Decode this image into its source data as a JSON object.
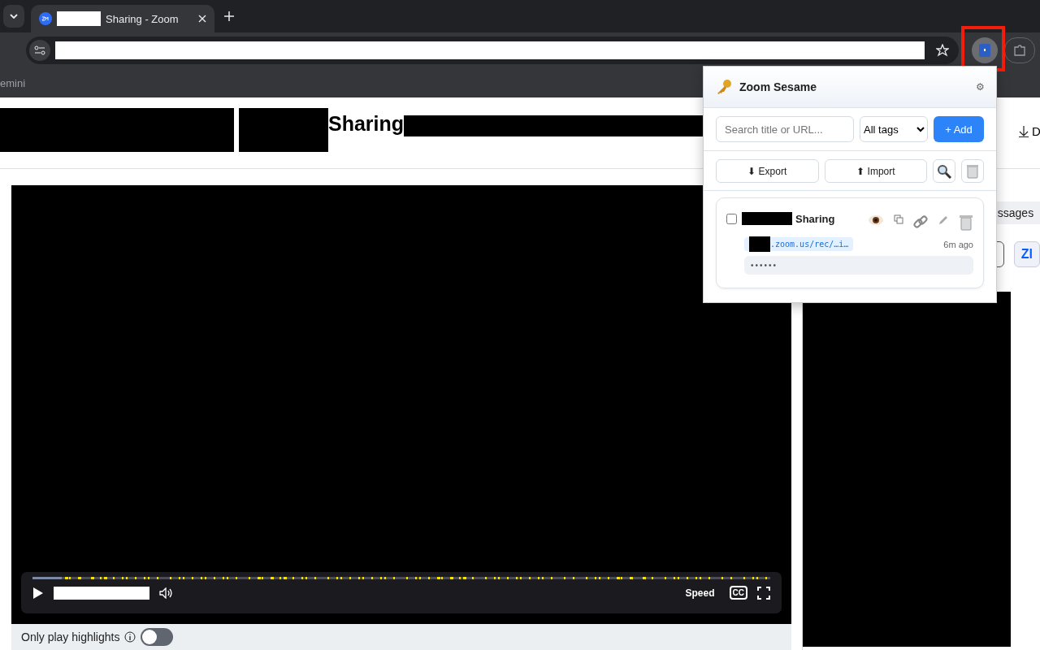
{
  "browser": {
    "tab": {
      "title": "Sharing - Zoom",
      "selected": true
    },
    "bookmark": "emini"
  },
  "page": {
    "title": "Sharing",
    "download": "D",
    "side_tab": "ssages",
    "side_button": "Zl"
  },
  "player": {
    "speed": "Speed",
    "cc": "CC",
    "highlights_label": "Only play highlights",
    "highlights_on": false
  },
  "popup": {
    "title": "Zoom Sesame",
    "settings": "⚙",
    "search": {
      "placeholder": "Search title or URL..."
    },
    "tag_filter": "All tags",
    "add": "+ Add",
    "export": "⬇ Export",
    "import": "⬆ Import",
    "entries": [
      {
        "title": "Sharing",
        "checked": false,
        "url": ".zoom.us/rec/…i…",
        "time": "6m ago",
        "password": "••••••"
      }
    ]
  }
}
